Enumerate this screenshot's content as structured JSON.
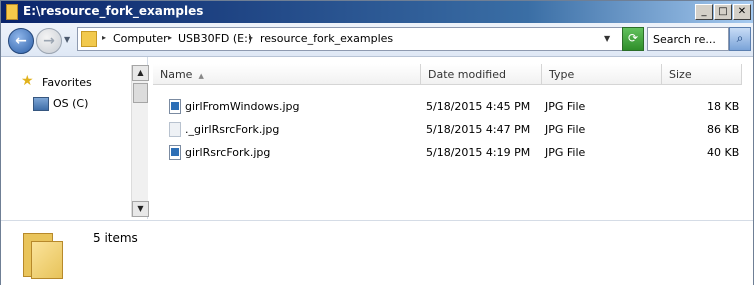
{
  "window": {
    "title": "E:\\resource_fork_examples",
    "controls": {
      "minimize": "_",
      "maximize": "□",
      "close": "✕"
    }
  },
  "address": {
    "breadcrumbs": [
      "Computer",
      "USB30FD (E:)",
      "resource_fork_examples"
    ],
    "search_placeholder": "Search re..."
  },
  "sidebar": {
    "items": [
      {
        "label": "Favorites",
        "icon": "star-icon"
      },
      {
        "label": "OS (C)",
        "icon": "drive-icon"
      }
    ]
  },
  "columns": {
    "name": "Name",
    "date": "Date modified",
    "type": "Type",
    "size": "Size"
  },
  "files": [
    {
      "name": "girlFromWindows.jpg",
      "date": "5/18/2015 4:45 PM",
      "type": "JPG File",
      "size": "18 KB",
      "icon": "jpg-file-icon"
    },
    {
      "name": "._girlRsrcFork.jpg",
      "date": "5/18/2015 4:47 PM",
      "type": "JPG File",
      "size": "86 KB",
      "icon": "hidden-file-icon"
    },
    {
      "name": "girlRsrcFork.jpg",
      "date": "5/18/2015 4:19 PM",
      "type": "JPG File",
      "size": "40 KB",
      "icon": "jpg-file-icon"
    }
  ],
  "status": {
    "count": "5 items"
  },
  "colors": {
    "title_bar": "#0a246a",
    "folder": "#f2c94c"
  }
}
